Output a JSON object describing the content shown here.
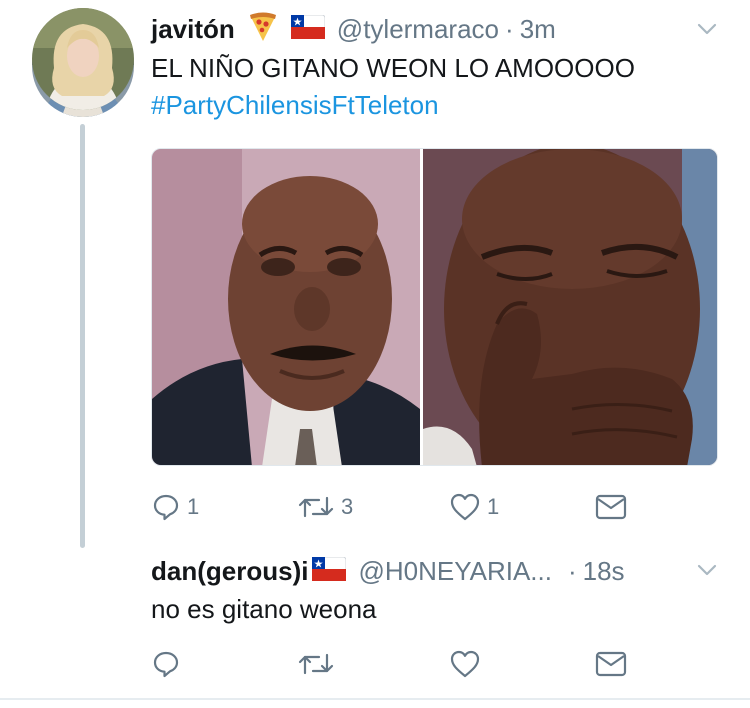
{
  "tweets": [
    {
      "name": "javitón",
      "emojis": [
        "pizza-icon",
        "chile-flag-icon"
      ],
      "handle": "@tylermaraco",
      "separator": "·",
      "time": "3m",
      "text_line_1": "EL NIÑO GITANO WEON LO AMOOOOO",
      "hashtag": "#PartyChilensisFtTeleton",
      "actions": {
        "reply_count": "1",
        "retweet_count": "3",
        "like_count": "1"
      }
    },
    {
      "name": "dan(gerous)i",
      "emojis": [
        "chile-flag-icon"
      ],
      "handle": "@H0NEYARIA...",
      "separator": "·",
      "time": "18s",
      "text_line_1": "no es gitano weona"
    }
  ],
  "colors": {
    "text": "#14171a",
    "secondary": "#657786",
    "link": "#1b95e0",
    "thread_line": "#c4cfd6",
    "divider": "#e6ecf0"
  }
}
